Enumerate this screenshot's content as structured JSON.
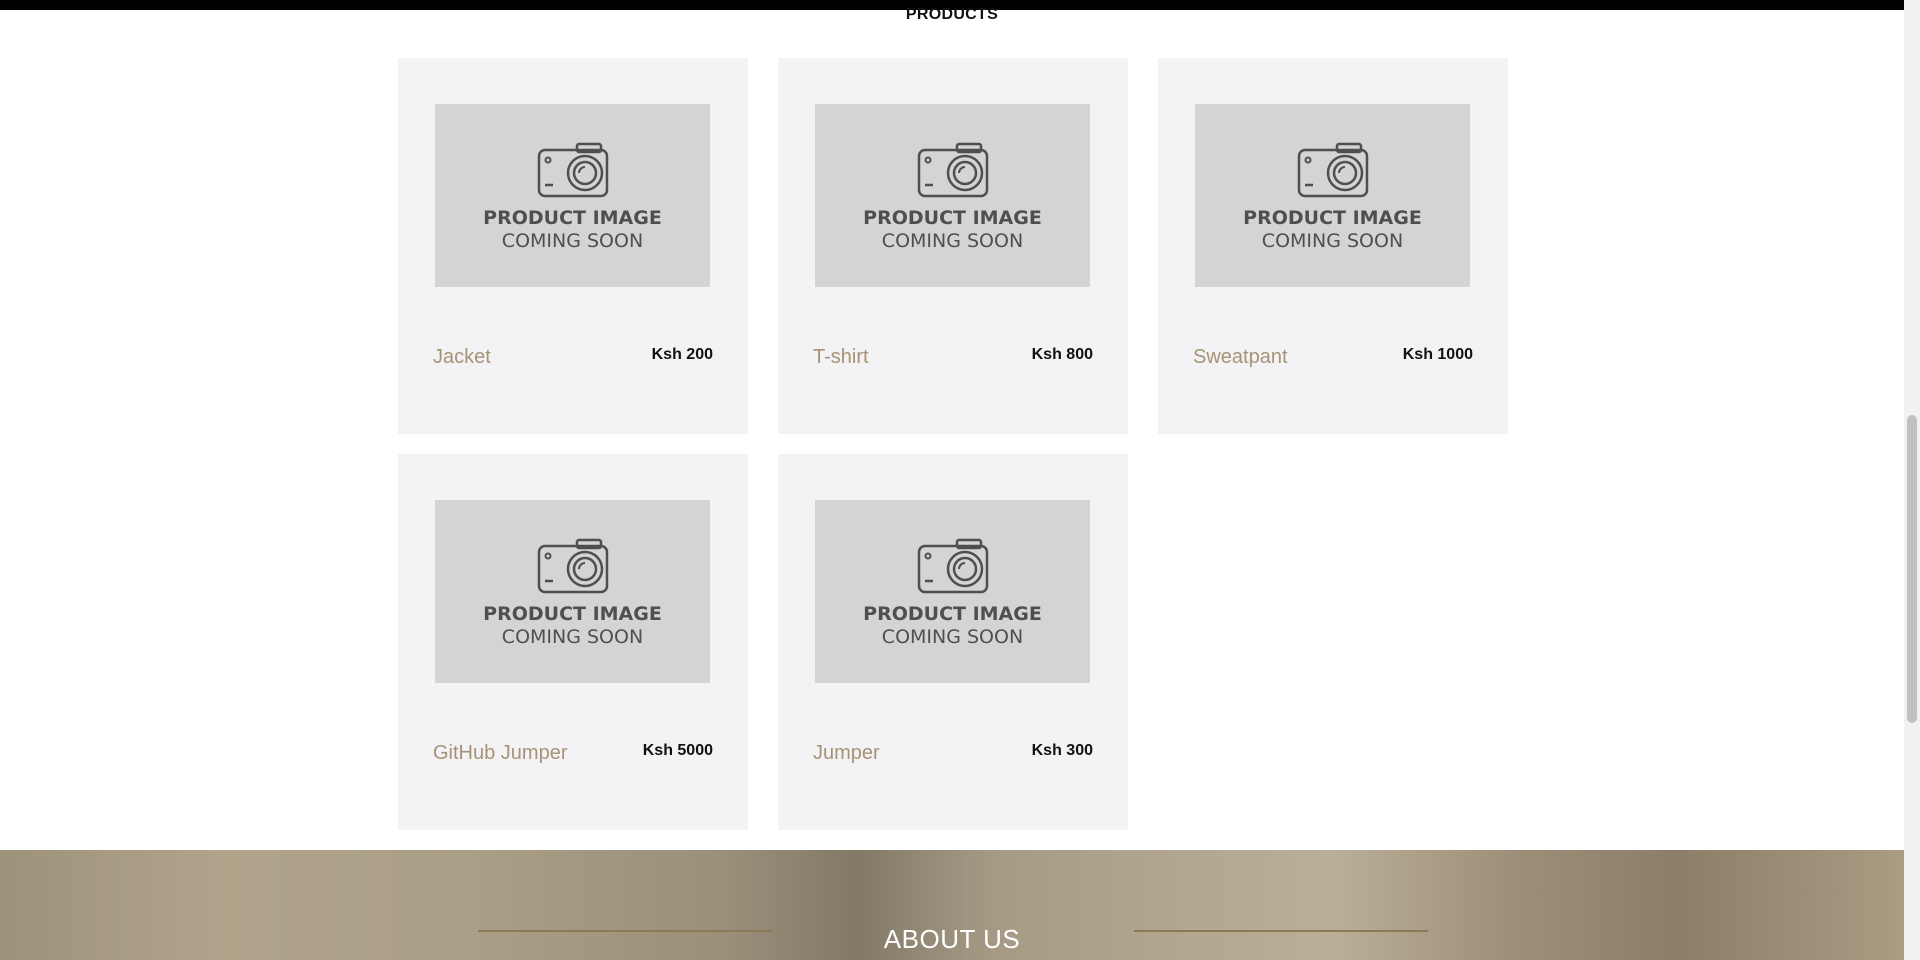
{
  "section_title": "PRODUCTS",
  "placeholder": {
    "line1": "PRODUCT IMAGE",
    "line2": "COMING SOON"
  },
  "products": [
    {
      "name": "Jacket",
      "price": "Ksh 200"
    },
    {
      "name": "T-shirt",
      "price": "Ksh 800"
    },
    {
      "name": "Sweatpant",
      "price": "Ksh 1000"
    },
    {
      "name": "GitHub Jumper",
      "price": "Ksh 5000"
    },
    {
      "name": "Jumper",
      "price": "Ksh 300"
    }
  ],
  "about": {
    "title": "ABOUT US"
  },
  "colors": {
    "product_name": "#a89275",
    "card_bg": "#f3f3f5",
    "placeholder_bg": "#d4d4d4"
  }
}
